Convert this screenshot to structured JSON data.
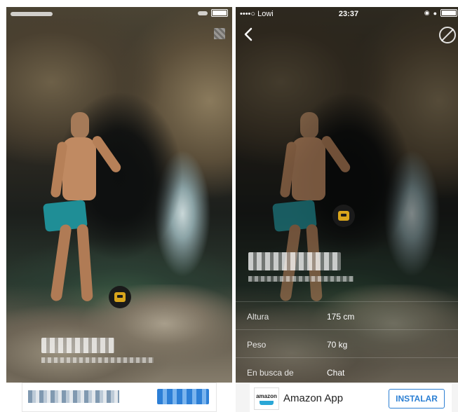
{
  "right_screen": {
    "status": {
      "carrier": "••••○ Lowi",
      "time": "23:37"
    },
    "details": [
      {
        "label": "Altura",
        "value": "175 cm"
      },
      {
        "label": "Peso",
        "value": "70 kg"
      },
      {
        "label": "En busca de",
        "value": "Chat"
      }
    ],
    "ad": {
      "title": "Amazon App",
      "logo_text": "amazon",
      "install_label": "INSTALAR"
    }
  },
  "icons": [
    "back-icon",
    "block-icon",
    "signal-icon",
    "battery-icon",
    "grindr-badge-icon",
    "amazon-logo-icon"
  ],
  "colors": {
    "install_accent": "#2b7fd3",
    "badge_yellow": "#d9a51c",
    "shorts_teal": "#1f8e96"
  }
}
